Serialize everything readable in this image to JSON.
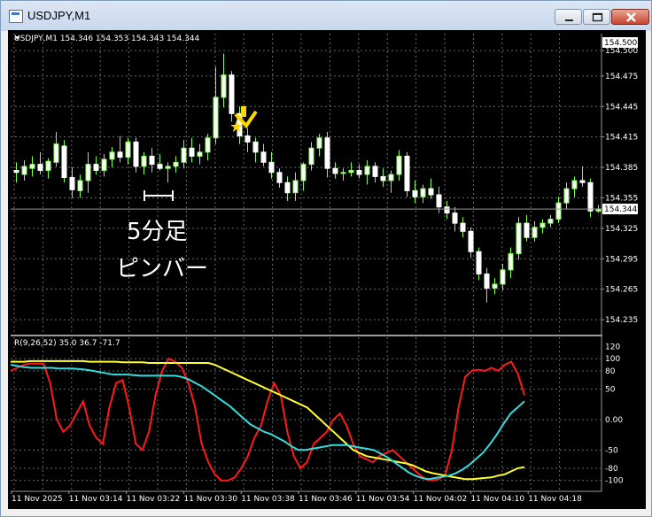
{
  "window": {
    "title": "USDJPY,M1",
    "buttons": [
      "minimize",
      "maximize",
      "close"
    ]
  },
  "header": {
    "symbol_line": "USDJPY,M1  154.346 154.353 154.343 154.344"
  },
  "indicator": {
    "label": "R(9,26,52) 35.0 36.7 -71.7"
  },
  "annotation": {
    "line1": "5分足",
    "line2": "ピンバー"
  },
  "price_scale": [
    "154.500",
    "154.475",
    "154.445",
    "154.415",
    "154.385",
    "154.355",
    "154.325",
    "154.295",
    "154.265",
    "154.235"
  ],
  "current_price": "154.344",
  "indicator_scale": [
    "120",
    "100",
    "80",
    "50",
    "0.00",
    "-50",
    "-80",
    "-100"
  ],
  "time_labels": [
    "11 Nov 2025",
    "11 Nov 03:14",
    "11 Nov 03:22",
    "11 Nov 03:30",
    "11 Nov 03:38",
    "11 Nov 03:46",
    "11 Nov 03:54",
    "11 Nov 04:02",
    "11 Nov 04:10",
    "11 Nov 04:18"
  ],
  "colors": {
    "background": "#000000",
    "candle": "#7fff50",
    "grid": "#bfbfbf",
    "line_red": "#ff1a1a",
    "line_yellow": "#ffff33",
    "line_cyan": "#33dddd",
    "annotation": "#ffd800"
  },
  "icons": [
    "chart-window-icon",
    "minimize-icon",
    "maximize-icon",
    "close-icon",
    "down-arrow-icon",
    "star-icon"
  ],
  "chart_data": {
    "type": "candlestick",
    "candles": [
      {
        "o": 154.382,
        "h": 154.39,
        "l": 154.37,
        "c": 154.38
      },
      {
        "o": 154.378,
        "h": 154.392,
        "l": 154.372,
        "c": 154.386
      },
      {
        "o": 154.384,
        "h": 154.396,
        "l": 154.376,
        "c": 154.388
      },
      {
        "o": 154.388,
        "h": 154.4,
        "l": 154.378,
        "c": 154.382
      },
      {
        "o": 154.382,
        "h": 154.394,
        "l": 154.374,
        "c": 154.391
      },
      {
        "o": 154.39,
        "h": 154.42,
        "l": 154.386,
        "c": 154.408
      },
      {
        "o": 154.406,
        "h": 154.412,
        "l": 154.37,
        "c": 154.375
      },
      {
        "o": 154.375,
        "h": 154.385,
        "l": 154.355,
        "c": 154.363
      },
      {
        "o": 154.362,
        "h": 154.378,
        "l": 154.355,
        "c": 154.372
      },
      {
        "o": 154.372,
        "h": 154.4,
        "l": 154.36,
        "c": 154.388
      },
      {
        "o": 154.388,
        "h": 154.396,
        "l": 154.378,
        "c": 154.382
      },
      {
        "o": 154.382,
        "h": 154.398,
        "l": 154.376,
        "c": 154.393
      },
      {
        "o": 154.393,
        "h": 154.405,
        "l": 154.385,
        "c": 154.4
      },
      {
        "o": 154.4,
        "h": 154.416,
        "l": 154.39,
        "c": 154.395
      },
      {
        "o": 154.395,
        "h": 154.414,
        "l": 154.388,
        "c": 154.41
      },
      {
        "o": 154.41,
        "h": 154.414,
        "l": 154.38,
        "c": 154.386
      },
      {
        "o": 154.386,
        "h": 154.4,
        "l": 154.378,
        "c": 154.396
      },
      {
        "o": 154.396,
        "h": 154.404,
        "l": 154.38,
        "c": 154.388
      },
      {
        "o": 154.388,
        "h": 154.398,
        "l": 154.382,
        "c": 154.384
      },
      {
        "o": 154.384,
        "h": 154.39,
        "l": 154.37,
        "c": 154.386
      },
      {
        "o": 154.386,
        "h": 154.396,
        "l": 154.38,
        "c": 154.39
      },
      {
        "o": 154.39,
        "h": 154.412,
        "l": 154.384,
        "c": 154.404
      },
      {
        "o": 154.404,
        "h": 154.414,
        "l": 154.39,
        "c": 154.396
      },
      {
        "o": 154.396,
        "h": 154.408,
        "l": 154.388,
        "c": 154.4
      },
      {
        "o": 154.4,
        "h": 154.418,
        "l": 154.392,
        "c": 154.414
      },
      {
        "o": 154.414,
        "h": 154.484,
        "l": 154.408,
        "c": 154.454
      },
      {
        "o": 154.454,
        "h": 154.497,
        "l": 154.444,
        "c": 154.476
      },
      {
        "o": 154.476,
        "h": 154.48,
        "l": 154.43,
        "c": 154.438
      },
      {
        "o": 154.438,
        "h": 154.445,
        "l": 154.408,
        "c": 154.416
      },
      {
        "o": 154.416,
        "h": 154.424,
        "l": 154.4,
        "c": 154.41
      },
      {
        "o": 154.41,
        "h": 154.414,
        "l": 154.39,
        "c": 154.4
      },
      {
        "o": 154.4,
        "h": 154.408,
        "l": 154.386,
        "c": 154.39
      },
      {
        "o": 154.39,
        "h": 154.4,
        "l": 154.374,
        "c": 154.38
      },
      {
        "o": 154.38,
        "h": 154.384,
        "l": 154.365,
        "c": 154.37
      },
      {
        "o": 154.37,
        "h": 154.376,
        "l": 154.352,
        "c": 154.36
      },
      {
        "o": 154.36,
        "h": 154.38,
        "l": 154.352,
        "c": 154.372
      },
      {
        "o": 154.372,
        "h": 154.39,
        "l": 154.362,
        "c": 154.388
      },
      {
        "o": 154.388,
        "h": 154.41,
        "l": 154.382,
        "c": 154.404
      },
      {
        "o": 154.404,
        "h": 154.418,
        "l": 154.396,
        "c": 154.414
      },
      {
        "o": 154.414,
        "h": 154.42,
        "l": 154.375,
        "c": 154.384
      },
      {
        "o": 154.384,
        "h": 154.39,
        "l": 154.374,
        "c": 154.379
      },
      {
        "o": 154.379,
        "h": 154.384,
        "l": 154.372,
        "c": 154.38
      },
      {
        "o": 154.38,
        "h": 154.39,
        "l": 154.376,
        "c": 154.382
      },
      {
        "o": 154.382,
        "h": 154.388,
        "l": 154.374,
        "c": 154.378
      },
      {
        "o": 154.378,
        "h": 154.392,
        "l": 154.368,
        "c": 154.386
      },
      {
        "o": 154.386,
        "h": 154.39,
        "l": 154.37,
        "c": 154.376
      },
      {
        "o": 154.376,
        "h": 154.384,
        "l": 154.366,
        "c": 154.372
      },
      {
        "o": 154.372,
        "h": 154.382,
        "l": 154.36,
        "c": 154.378
      },
      {
        "o": 154.378,
        "h": 154.402,
        "l": 154.372,
        "c": 154.396
      },
      {
        "o": 154.396,
        "h": 154.4,
        "l": 154.356,
        "c": 154.362
      },
      {
        "o": 154.362,
        "h": 154.372,
        "l": 154.35,
        "c": 154.356
      },
      {
        "o": 154.356,
        "h": 154.368,
        "l": 154.35,
        "c": 154.364
      },
      {
        "o": 154.364,
        "h": 154.374,
        "l": 154.354,
        "c": 154.358
      },
      {
        "o": 154.358,
        "h": 154.366,
        "l": 154.34,
        "c": 154.346
      },
      {
        "o": 154.346,
        "h": 154.352,
        "l": 154.334,
        "c": 154.34
      },
      {
        "o": 154.34,
        "h": 154.346,
        "l": 154.322,
        "c": 154.33
      },
      {
        "o": 154.33,
        "h": 154.336,
        "l": 154.316,
        "c": 154.322
      },
      {
        "o": 154.322,
        "h": 154.326,
        "l": 154.296,
        "c": 154.302
      },
      {
        "o": 154.302,
        "h": 154.306,
        "l": 154.274,
        "c": 154.28
      },
      {
        "o": 154.28,
        "h": 154.286,
        "l": 154.252,
        "c": 154.266
      },
      {
        "o": 154.266,
        "h": 154.276,
        "l": 154.26,
        "c": 154.27
      },
      {
        "o": 154.27,
        "h": 154.29,
        "l": 154.264,
        "c": 154.284
      },
      {
        "o": 154.284,
        "h": 154.306,
        "l": 154.276,
        "c": 154.3
      },
      {
        "o": 154.3,
        "h": 154.336,
        "l": 154.294,
        "c": 154.33
      },
      {
        "o": 154.33,
        "h": 154.338,
        "l": 154.312,
        "c": 154.316
      },
      {
        "o": 154.316,
        "h": 154.332,
        "l": 154.312,
        "c": 154.326
      },
      {
        "o": 154.326,
        "h": 154.334,
        "l": 154.32,
        "c": 154.33
      },
      {
        "o": 154.33,
        "h": 154.338,
        "l": 154.326,
        "c": 154.334
      },
      {
        "o": 154.334,
        "h": 154.356,
        "l": 154.33,
        "c": 154.35
      },
      {
        "o": 154.35,
        "h": 154.37,
        "l": 154.344,
        "c": 154.364
      },
      {
        "o": 154.364,
        "h": 154.376,
        "l": 154.356,
        "c": 154.372
      },
      {
        "o": 154.372,
        "h": 154.386,
        "l": 154.366,
        "c": 154.37
      },
      {
        "o": 154.37,
        "h": 154.374,
        "l": 154.336,
        "c": 154.342
      },
      {
        "o": 154.342,
        "h": 154.348,
        "l": 154.34,
        "c": 154.344
      }
    ],
    "ylim": [
      154.222,
      154.508
    ],
    "indicator_series": [
      {
        "values": [
          80,
          85,
          90,
          92,
          92,
          92,
          60,
          0,
          -20,
          -10,
          10,
          30,
          -10,
          -30,
          -40,
          20,
          60,
          65,
          20,
          -40,
          -50,
          -20,
          40,
          80,
          100,
          95,
          85,
          60,
          20,
          -40,
          -70,
          -90,
          -100,
          -100,
          -95,
          -80,
          -60,
          -30,
          -10,
          30,
          60,
          40,
          -20,
          -60,
          -80,
          -70,
          -40,
          -30,
          -20,
          0,
          10,
          -10,
          -40,
          -60,
          -65,
          -70,
          -60,
          -55,
          -50,
          -60,
          -70,
          -80,
          -90,
          -98,
          -100,
          -98,
          -90,
          -50,
          20,
          70,
          80,
          82,
          80,
          85,
          80,
          90,
          95,
          75,
          40
        ]
      },
      {
        "values": [
          95,
          95,
          95,
          96,
          96,
          96,
          96,
          96,
          96,
          96,
          96,
          96,
          95,
          95,
          95,
          95,
          95,
          94,
          94,
          94,
          94,
          93,
          93,
          93,
          93,
          93,
          93,
          93,
          93,
          93,
          93,
          90,
          85,
          80,
          75,
          70,
          65,
          60,
          55,
          50,
          45,
          40,
          35,
          30,
          25,
          20,
          10,
          0,
          -10,
          -20,
          -30,
          -40,
          -50,
          -55,
          -60,
          -62,
          -64,
          -66,
          -68,
          -70,
          -72,
          -75,
          -80,
          -85,
          -88,
          -90,
          -92,
          -94,
          -96,
          -98,
          -98,
          -97,
          -96,
          -95,
          -92,
          -90,
          -85,
          -80,
          -78
        ]
      },
      {
        "values": [
          90,
          88,
          86,
          85,
          85,
          85,
          85,
          84,
          84,
          84,
          83,
          82,
          80,
          78,
          76,
          74,
          74,
          74,
          73,
          72,
          72,
          72,
          72,
          72,
          72,
          70,
          66,
          60,
          54,
          46,
          38,
          30,
          22,
          12,
          2,
          -8,
          -14,
          -20,
          -24,
          -30,
          -36,
          -44,
          -50,
          -50,
          -48,
          -46,
          -44,
          -42,
          -42,
          -42,
          -44,
          -46,
          -48,
          -50,
          -56,
          -62,
          -70,
          -78,
          -86,
          -92,
          -96,
          -98,
          -96,
          -94,
          -92,
          -88,
          -82,
          -74,
          -64,
          -54,
          -40,
          -24,
          -6,
          10,
          20,
          30
        ]
      }
    ],
    "indicator_ylim": [
      -115,
      125
    ]
  }
}
